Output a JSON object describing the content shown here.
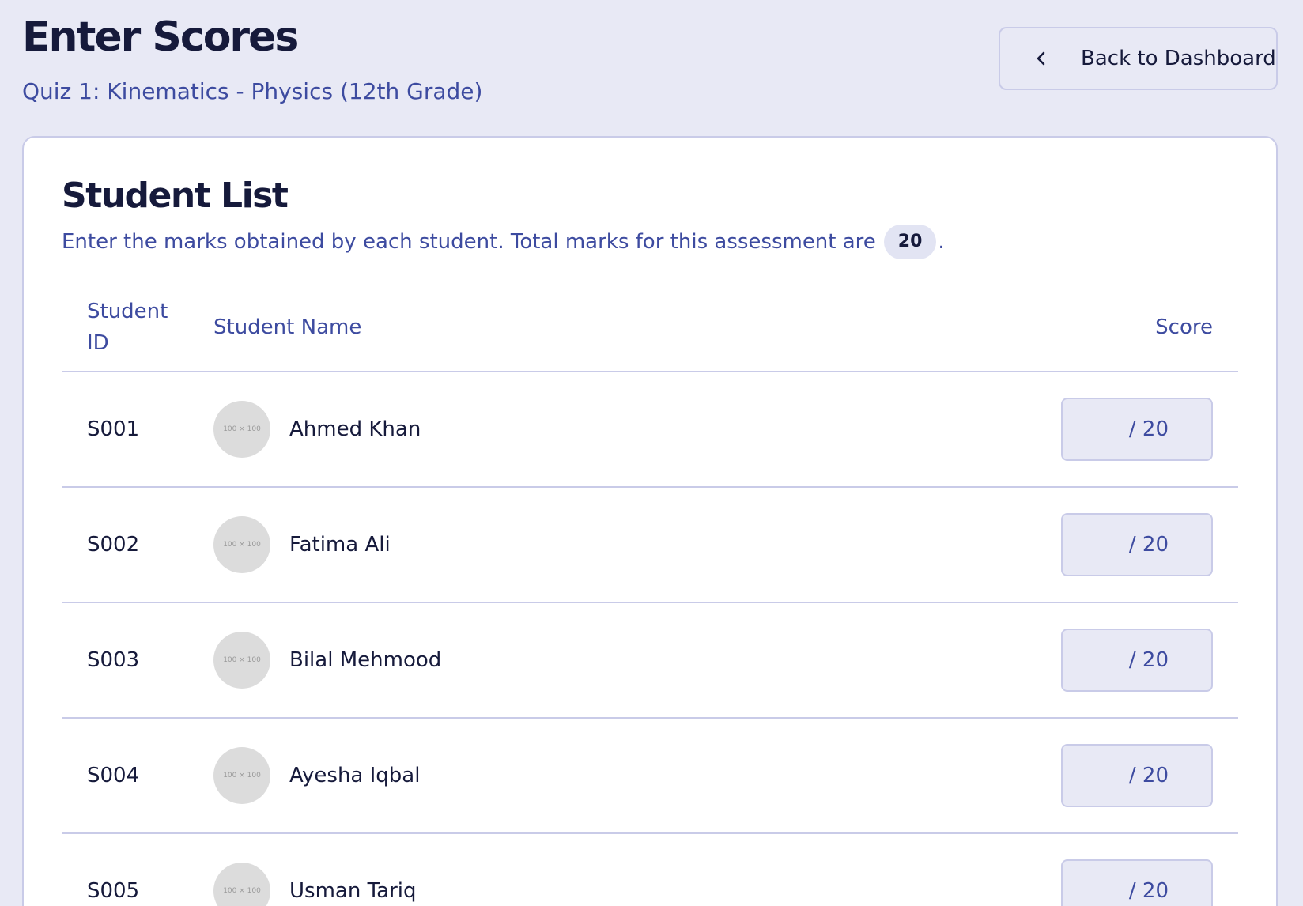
{
  "header": {
    "title": "Enter Scores",
    "subtitle": "Quiz 1: Kinematics - Physics (12th Grade)",
    "back_label": "Back to Dashboard"
  },
  "card": {
    "title": "Student List",
    "description": "Enter the marks obtained by each student. Total marks for this assessment are",
    "total_marks": "20",
    "period": "."
  },
  "table": {
    "columns": {
      "id": "Student ID",
      "name": "Student Name",
      "score": "Score"
    },
    "rows": [
      {
        "id": "S001",
        "name": "Ahmed Khan",
        "avatar": "100 × 100",
        "score": "",
        "suffix": "/ 20"
      },
      {
        "id": "S002",
        "name": "Fatima Ali",
        "avatar": "100 × 100",
        "score": "",
        "suffix": "/ 20"
      },
      {
        "id": "S003",
        "name": "Bilal Mehmood",
        "avatar": "100 × 100",
        "score": "",
        "suffix": "/ 20"
      },
      {
        "id": "S004",
        "name": "Ayesha Iqbal",
        "avatar": "100 × 100",
        "score": "",
        "suffix": "/ 20"
      },
      {
        "id": "S005",
        "name": "Usman Tariq",
        "avatar": "100 × 100",
        "score": "",
        "suffix": "/ 20"
      }
    ]
  },
  "icons": {
    "back": "chevron-left-icon"
  },
  "colors": {
    "background": "#e8e9f5",
    "accent_text": "#3d4ba0",
    "primary_text": "#161a3b",
    "border": "#c9cbe8"
  }
}
